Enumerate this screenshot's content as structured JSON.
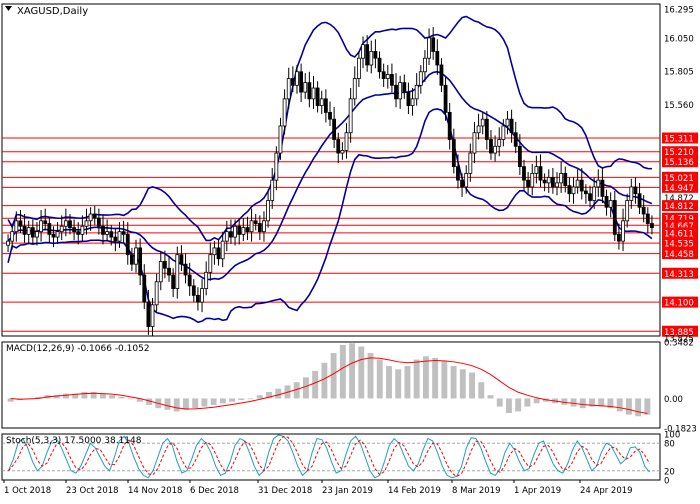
{
  "app": {
    "symbol_title": "XAGUSD,Daily"
  },
  "colors": {
    "frame": "#000000",
    "price_line": "#ff0000",
    "price_label_bg": "#ff0000",
    "candle": "#000000",
    "bollinger": "#0000a0",
    "macd_hist": "#c0c0c0",
    "macd_signal": "#ff0000",
    "stoch_main": "#20a0c0",
    "stoch_signal": "#ff0000",
    "label_text": "#ffffff"
  },
  "chart_data": [
    {
      "type": "candlestick",
      "title": "XAGUSD,Daily",
      "ylim": [
        13.85,
        16.3
      ],
      "price_ticks": [
        "16.295",
        "16.050",
        "15.805",
        "15.560",
        "15.311",
        "15.210",
        "15.136",
        "15.021",
        "14.947",
        "14.872",
        "14.812",
        "14.719",
        "14.667",
        "14.611",
        "14.535",
        "14.458",
        "14.313",
        "14.100",
        "13.885",
        "13.825"
      ],
      "horizontal_levels": [
        15.311,
        15.21,
        15.136,
        15.021,
        14.947,
        14.812,
        14.719,
        14.667,
        14.611,
        14.535,
        14.458,
        14.313,
        14.1,
        13.885
      ],
      "x_labels": [
        "1 Oct 2018",
        "23 Oct 2018",
        "14 Nov 2018",
        "6 Dec 2018",
        "31 Dec 2018",
        "23 Jan 2019",
        "14 Feb 2019",
        "8 Mar 2019",
        "1 Apr 2019",
        "24 Apr 2019"
      ],
      "close_series": [
        14.55,
        14.62,
        14.7,
        14.66,
        14.6,
        14.65,
        14.58,
        14.62,
        14.7,
        14.68,
        14.6,
        14.58,
        14.62,
        14.66,
        14.7,
        14.65,
        14.62,
        14.6,
        14.66,
        14.7,
        14.75,
        14.72,
        14.66,
        14.6,
        14.62,
        14.58,
        14.55,
        14.62,
        14.6,
        14.45,
        14.38,
        14.5,
        14.3,
        14.1,
        13.92,
        14.08,
        14.25,
        14.4,
        14.35,
        14.3,
        14.2,
        14.45,
        14.38,
        14.3,
        14.22,
        14.15,
        14.1,
        14.2,
        14.32,
        14.45,
        14.5,
        14.42,
        14.55,
        14.62,
        14.58,
        14.66,
        14.6,
        14.65,
        14.62,
        14.7,
        14.68,
        14.62,
        14.7,
        14.85,
        15.0,
        15.2,
        15.4,
        15.6,
        15.75,
        15.7,
        15.8,
        15.65,
        15.72,
        15.6,
        15.68,
        15.55,
        15.6,
        15.5,
        15.45,
        15.3,
        15.2,
        15.22,
        15.35,
        15.6,
        15.75,
        15.9,
        16.0,
        15.85,
        15.95,
        15.9,
        15.8,
        15.75,
        15.78,
        15.7,
        15.6,
        15.72,
        15.65,
        15.55,
        15.6,
        15.7,
        15.8,
        15.9,
        16.05,
        15.95,
        15.85,
        15.7,
        15.5,
        15.3,
        15.1,
        15.0,
        14.95,
        15.05,
        15.2,
        15.35,
        15.4,
        15.45,
        15.3,
        15.2,
        15.25,
        15.3,
        15.4,
        15.45,
        15.35,
        15.25,
        15.1,
        15.0,
        14.95,
        15.05,
        15.1,
        15.0,
        14.98,
        15.02,
        14.95,
        14.98,
        15.05,
        14.96,
        14.9,
        14.95,
        15.0,
        14.92,
        14.9,
        14.85,
        14.95,
        15.0,
        14.88,
        14.8,
        14.85,
        14.6,
        14.55,
        14.7,
        14.85,
        14.95,
        14.9,
        14.8,
        14.75,
        14.68,
        14.65
      ]
    },
    {
      "type": "bar",
      "title": "MACD(12,26,9) -0.1066 -0.1052",
      "yticks": [
        "0.3482",
        "0.00",
        "-0.1823"
      ],
      "ylim": [
        -0.1823,
        0.3482
      ],
      "series_names": [
        "MACD",
        "Signal"
      ],
      "macd_values": [
        -0.02,
        -0.01,
        0.0,
        0.01,
        0.02,
        0.02,
        0.03,
        0.03,
        0.04,
        0.04,
        0.03,
        0.02,
        0.01,
        0.0,
        -0.02,
        -0.04,
        -0.06,
        -0.07,
        -0.08,
        -0.07,
        -0.06,
        -0.05,
        -0.04,
        -0.03,
        -0.02,
        -0.01,
        0.0,
        0.02,
        0.04,
        0.06,
        0.08,
        0.1,
        0.13,
        0.17,
        0.22,
        0.28,
        0.33,
        0.34,
        0.32,
        0.28,
        0.24,
        0.2,
        0.18,
        0.2,
        0.24,
        0.26,
        0.25,
        0.23,
        0.2,
        0.18,
        0.16,
        0.1,
        0.02,
        -0.05,
        -0.09,
        -0.08,
        -0.05,
        -0.03,
        -0.02,
        -0.03,
        -0.04,
        -0.05,
        -0.06,
        -0.05,
        -0.05,
        -0.06,
        -0.08,
        -0.1,
        -0.11,
        -0.1
      ],
      "signal_values": [
        0.0,
        -0.005,
        -0.003,
        0.0,
        0.01,
        0.015,
        0.02,
        0.025,
        0.03,
        0.032,
        0.03,
        0.027,
        0.02,
        0.01,
        0.0,
        -0.015,
        -0.03,
        -0.045,
        -0.058,
        -0.065,
        -0.064,
        -0.06,
        -0.054,
        -0.046,
        -0.037,
        -0.028,
        -0.018,
        -0.006,
        0.008,
        0.022,
        0.038,
        0.055,
        0.074,
        0.096,
        0.121,
        0.152,
        0.188,
        0.218,
        0.24,
        0.25,
        0.248,
        0.238,
        0.226,
        0.22,
        0.224,
        0.23,
        0.234,
        0.232,
        0.226,
        0.216,
        0.202,
        0.18,
        0.148,
        0.108,
        0.068,
        0.038,
        0.02,
        0.004,
        -0.008,
        -0.016,
        -0.024,
        -0.03,
        -0.037,
        -0.042,
        -0.045,
        -0.05,
        -0.057,
        -0.068,
        -0.082,
        -0.093
      ]
    },
    {
      "type": "line",
      "title": "Stoch(5,3,3) 17.5000 38.1148",
      "yticks": [
        "100",
        "80",
        "20",
        "0"
      ],
      "ylim": [
        0,
        100
      ],
      "levels": [
        80,
        20
      ],
      "series_names": [
        "Main",
        "Signal"
      ],
      "main_values": [
        20,
        45,
        80,
        90,
        70,
        40,
        20,
        30,
        60,
        85,
        90,
        70,
        45,
        20,
        15,
        30,
        55,
        80,
        70,
        50,
        30,
        20,
        50,
        85,
        95,
        80,
        50,
        25,
        10,
        5,
        20,
        50,
        80,
        90,
        75,
        40,
        15,
        20,
        45,
        75,
        90,
        80,
        60,
        30,
        10,
        15,
        40,
        75,
        90,
        85,
        60,
        30,
        10,
        20,
        60,
        90,
        98,
        95,
        85,
        60,
        30,
        10,
        20,
        60,
        90,
        88,
        70,
        40,
        15,
        20,
        55,
        85,
        95,
        80,
        50,
        20,
        5,
        10,
        40,
        75,
        90,
        80,
        55,
        30,
        20,
        35,
        65,
        90,
        85,
        60,
        30,
        10,
        5,
        8,
        30,
        70,
        92,
        90,
        70,
        40,
        15,
        10,
        25,
        60,
        80,
        65,
        40,
        20,
        25,
        55,
        80,
        85,
        60,
        35,
        20,
        15,
        35,
        65,
        85,
        70,
        45,
        20,
        30,
        60,
        80,
        75,
        55,
        35,
        45,
        70,
        72,
        60,
        30,
        17
      ]
    }
  ]
}
